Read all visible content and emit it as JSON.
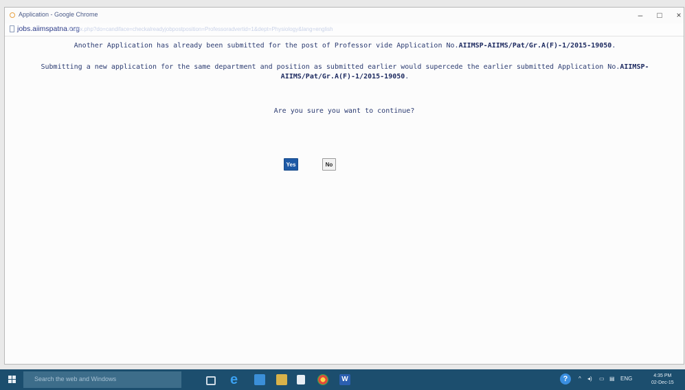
{
  "window": {
    "title": "Application - Google Chrome",
    "controls": {
      "minimize": "–",
      "maximize": "□",
      "close": "×"
    }
  },
  "address_bar": {
    "domain": "jobs.aiimspatna.org",
    "path": "/index.php?do=candiface=checkalreadyjobpostposition=Professoradvertid=1&dept=Physiology&lang=english"
  },
  "dialog": {
    "message1_pre": "Another Application has already been submitted for the post of Professor vide Application No.",
    "message1_appno": "AIIMSP-AIIMS/Pat/Gr.A(F)-1/2015-19050",
    "message1_post": ".",
    "message2_pre": "Submitting a new application for the same department and position as submitted earlier would supercede the earlier submitted Application No.",
    "message2_appno": "AIIMSP-AIIMS/Pat/Gr.A(F)-1/2015-19050",
    "message2_post": ".",
    "question": "Are you sure you want to continue?",
    "yes_label": "Yes",
    "no_label": "No"
  },
  "taskbar": {
    "search_placeholder": "Search the web and Windows",
    "tray_language": "ENG",
    "tray_help": "?",
    "clock_time": "4:35 PM",
    "clock_date": "02-Dec-15"
  },
  "colors": {
    "taskbar": "#1c4e6e",
    "yes_button": "#1e5aa6",
    "message_text": "#2a3a70"
  }
}
